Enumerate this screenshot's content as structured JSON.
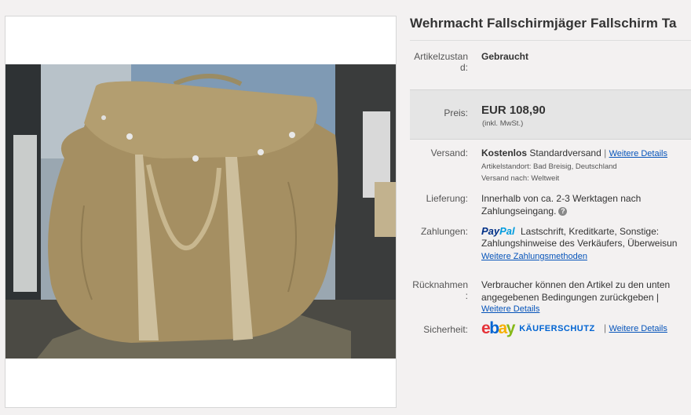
{
  "title": "Wehrmacht Fallschirmjäger Fallschirm Ta",
  "condition": {
    "label_line1": "Artikelzustan",
    "label_line2": "d:",
    "value": "Gebraucht"
  },
  "price": {
    "label": "Preis:",
    "value": "EUR 108,90",
    "note": "(inkl. MwSt.)"
  },
  "shipping": {
    "label": "Versand:",
    "free": "Kostenlos",
    "method": "Standardversand",
    "sep": "|",
    "details_link": "Weitere Details",
    "location": "Artikelstandort: Bad Breisig, Deutschland",
    "ships_to": "Versand nach: Weltweit"
  },
  "delivery": {
    "label": "Lieferung:",
    "line1": "Innerhalb von ca. 2-3 Werktagen nach",
    "line2": "Zahlungseingang."
  },
  "payments": {
    "label": "Zahlungen:",
    "paypal_pay": "Pay",
    "paypal_pal": "Pal",
    "line1": "Lastschrift,  Kreditkarte,  Sonstige:",
    "line2": "Zahlungshinweise des Verkäufers,  Überweisun",
    "more_link": "Weitere Zahlungsmethoden"
  },
  "returns": {
    "label_line1": "Rücknahmen",
    "label_line2": ":",
    "line1": "Verbraucher können den Artikel zu den unten",
    "line2": "angegebenen Bedingungen zurückgeben |",
    "details_link": "Weitere Details"
  },
  "security": {
    "label": "Sicherheit:",
    "ebay_e": "e",
    "ebay_b": "b",
    "ebay_a": "a",
    "ebay_y": "y",
    "protection": "KÄUFERSCHUTZ",
    "sep": "|",
    "details_link": "Weitere Details"
  },
  "colors": {
    "link": "#0654ba",
    "paypal_dark": "#003087",
    "paypal_light": "#009cde",
    "ebay_red": "#e53238",
    "ebay_blue": "#0064d2",
    "ebay_yellow": "#f5af02",
    "ebay_green": "#86b817"
  }
}
